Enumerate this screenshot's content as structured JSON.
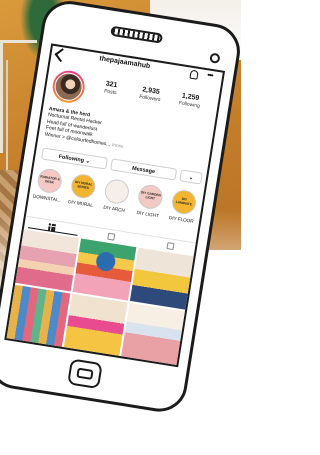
{
  "profile": {
    "username": "thepajaamahub",
    "stats": [
      {
        "value": "321",
        "label": "Posts"
      },
      {
        "value": "2,935",
        "label": "Followers"
      },
      {
        "value": "1,259",
        "label": "Following"
      }
    ],
    "bio": {
      "name": "Amara & the herd",
      "lines": [
        "Nocturnal Rental Hacker",
        "Head full of wanderlust",
        "Feet full of moonwalk",
        "Winner > @colourfedhomes..."
      ],
      "more": "more"
    }
  },
  "actions": {
    "following": "Following",
    "message": "Message",
    "suggest": ""
  },
  "highlights": [
    {
      "label": "DOWNSTAI...",
      "cover": "RADIATOR & DESK",
      "color": "#f4c9c4"
    },
    {
      "label": "DIY MURAL",
      "cover": "DIY MURAL SERIES",
      "color": "#f3b52f"
    },
    {
      "label": "DIY ARCH",
      "cover": "",
      "color": "#f6efe8"
    },
    {
      "label": "DIY LIGHT",
      "cover": "DIY GARDEN LIGHT",
      "color": "#f2c9c3"
    },
    {
      "label": "DIY FLOOR",
      "cover": "DIY LAMINATE",
      "color": "#f3b52f"
    }
  ],
  "colors": {
    "story_ring_start": "#e9368a",
    "story_ring_end": "#f79a2b",
    "outline": "#1b1b1b"
  }
}
